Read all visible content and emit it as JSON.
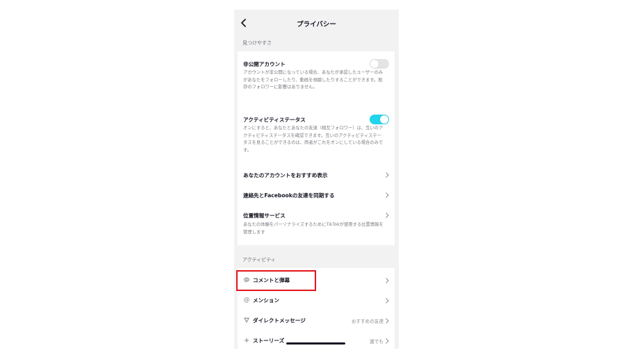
{
  "header": {
    "title": "プライバシー"
  },
  "discoverability": {
    "section_label": "見つけやすさ",
    "private_account": {
      "title": "非公開アカウント",
      "desc": "アカウントが非公開になっている場合、あなたが承認したユーザーのみがあなたをフォローしたり、動画を視聴したりすることができます。既存のフォロワーに影響はありません。",
      "toggle_state": "off"
    },
    "activity_status": {
      "title": "アクティビティステータス",
      "desc": "オンにすると、あなたとあなたの友達（相互フォロワー）は、互いのアクティビティステータスを確認できます。互いのアクティビティステータスを見ることができるのは、両者がこれをオンにしている場合のみです。",
      "toggle_state": "on"
    },
    "suggest_account": {
      "title": "あなたのアカウントをおすすめ表示"
    },
    "sync_contacts": {
      "title": "連絡先とFacebookの友達を同期する"
    },
    "location": {
      "title": "位置情報サービス",
      "desc": "あなたの体験をパーソナライズするためにTikTokが使用する位置情報を管理します"
    }
  },
  "activity": {
    "section_label": "アクティビティ",
    "items": [
      {
        "label": "コメントと弾幕",
        "icon": "comment-icon",
        "value": ""
      },
      {
        "label": "メンション",
        "icon": "at-icon",
        "value": ""
      },
      {
        "label": "ダイレクトメッセージ",
        "icon": "direct-message-icon",
        "value": "おすすめの友達"
      },
      {
        "label": "ストーリーズ",
        "icon": "sparkle-icon",
        "value": "誰でも"
      }
    ]
  },
  "colors": {
    "toggle_on": "#20d5ec",
    "highlight": "#e5131c"
  }
}
